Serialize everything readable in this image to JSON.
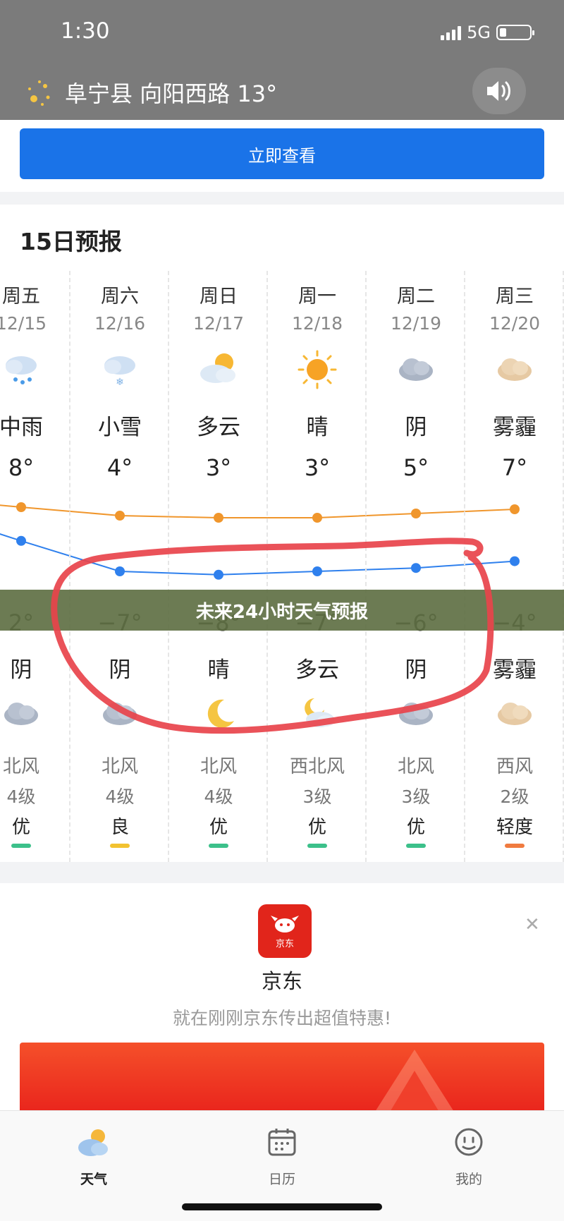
{
  "status_bar": {
    "time": "1:30",
    "network": "5G"
  },
  "header": {
    "location": "阜宁县 向阳西路 13°",
    "speaker_icon": "speaker-icon"
  },
  "cta": {
    "label": "立即查看",
    "color": "#1a73e8"
  },
  "forecast": {
    "title": "15日预报",
    "days": [
      {
        "dow": "周五",
        "date": "12/15",
        "day_icon": "rain-cloud-icon",
        "day_weather": "中雨",
        "high": "8°",
        "low": "2°",
        "night_weather": "阴",
        "night_icon": "cloud-icon",
        "wind": "北风",
        "wind_level": "4级",
        "aqi": "优",
        "aqi_color": "#3cc08a"
      },
      {
        "dow": "周六",
        "date": "12/16",
        "day_icon": "snow-cloud-icon",
        "day_weather": "小雪",
        "high": "4°",
        "low": "−7°",
        "night_weather": "阴",
        "night_icon": "cloud-icon",
        "wind": "北风",
        "wind_level": "4级",
        "aqi": "良",
        "aqi_color": "#f2c230"
      },
      {
        "dow": "周日",
        "date": "12/17",
        "day_icon": "partly-cloudy-icon",
        "day_weather": "多云",
        "high": "3°",
        "low": "−8°",
        "night_weather": "晴",
        "night_icon": "moon-icon",
        "wind": "北风",
        "wind_level": "4级",
        "aqi": "优",
        "aqi_color": "#3cc08a"
      },
      {
        "dow": "周一",
        "date": "12/18",
        "day_icon": "sun-icon",
        "day_weather": "晴",
        "high": "3°",
        "low": "−7°",
        "night_weather": "多云",
        "night_icon": "moon-cloud-icon",
        "wind": "西北风",
        "wind_level": "3级",
        "aqi": "优",
        "aqi_color": "#3cc08a"
      },
      {
        "dow": "周二",
        "date": "12/19",
        "day_icon": "cloud-icon",
        "day_weather": "阴",
        "high": "5°",
        "low": "−6°",
        "night_weather": "阴",
        "night_icon": "cloud-icon",
        "wind": "北风",
        "wind_level": "3级",
        "aqi": "优",
        "aqi_color": "#3cc08a"
      },
      {
        "dow": "周三",
        "date": "12/20",
        "day_icon": "haze-icon",
        "day_weather": "雾霾",
        "high": "7°",
        "low": "−4°",
        "night_weather": "雾霾",
        "night_icon": "haze-icon",
        "wind": "西风",
        "wind_level": "2级",
        "aqi": "轻度",
        "aqi_color": "#f07b3f"
      }
    ],
    "high_line_color": "#f0962c",
    "low_line_color": "#2f80ed"
  },
  "overlay_banner": "未来24小时天气预报",
  "annotation_color": "#e8434b",
  "ad": {
    "name": "京东",
    "logo_text": "京东",
    "description": "就在刚刚京东传出超值特惠!",
    "close_icon": "close-icon"
  },
  "nav": [
    {
      "label": "天气",
      "icon": "weather-icon",
      "active": true
    },
    {
      "label": "日历",
      "icon": "calendar-icon",
      "active": false
    },
    {
      "label": "我的",
      "icon": "profile-icon",
      "active": false
    }
  ]
}
